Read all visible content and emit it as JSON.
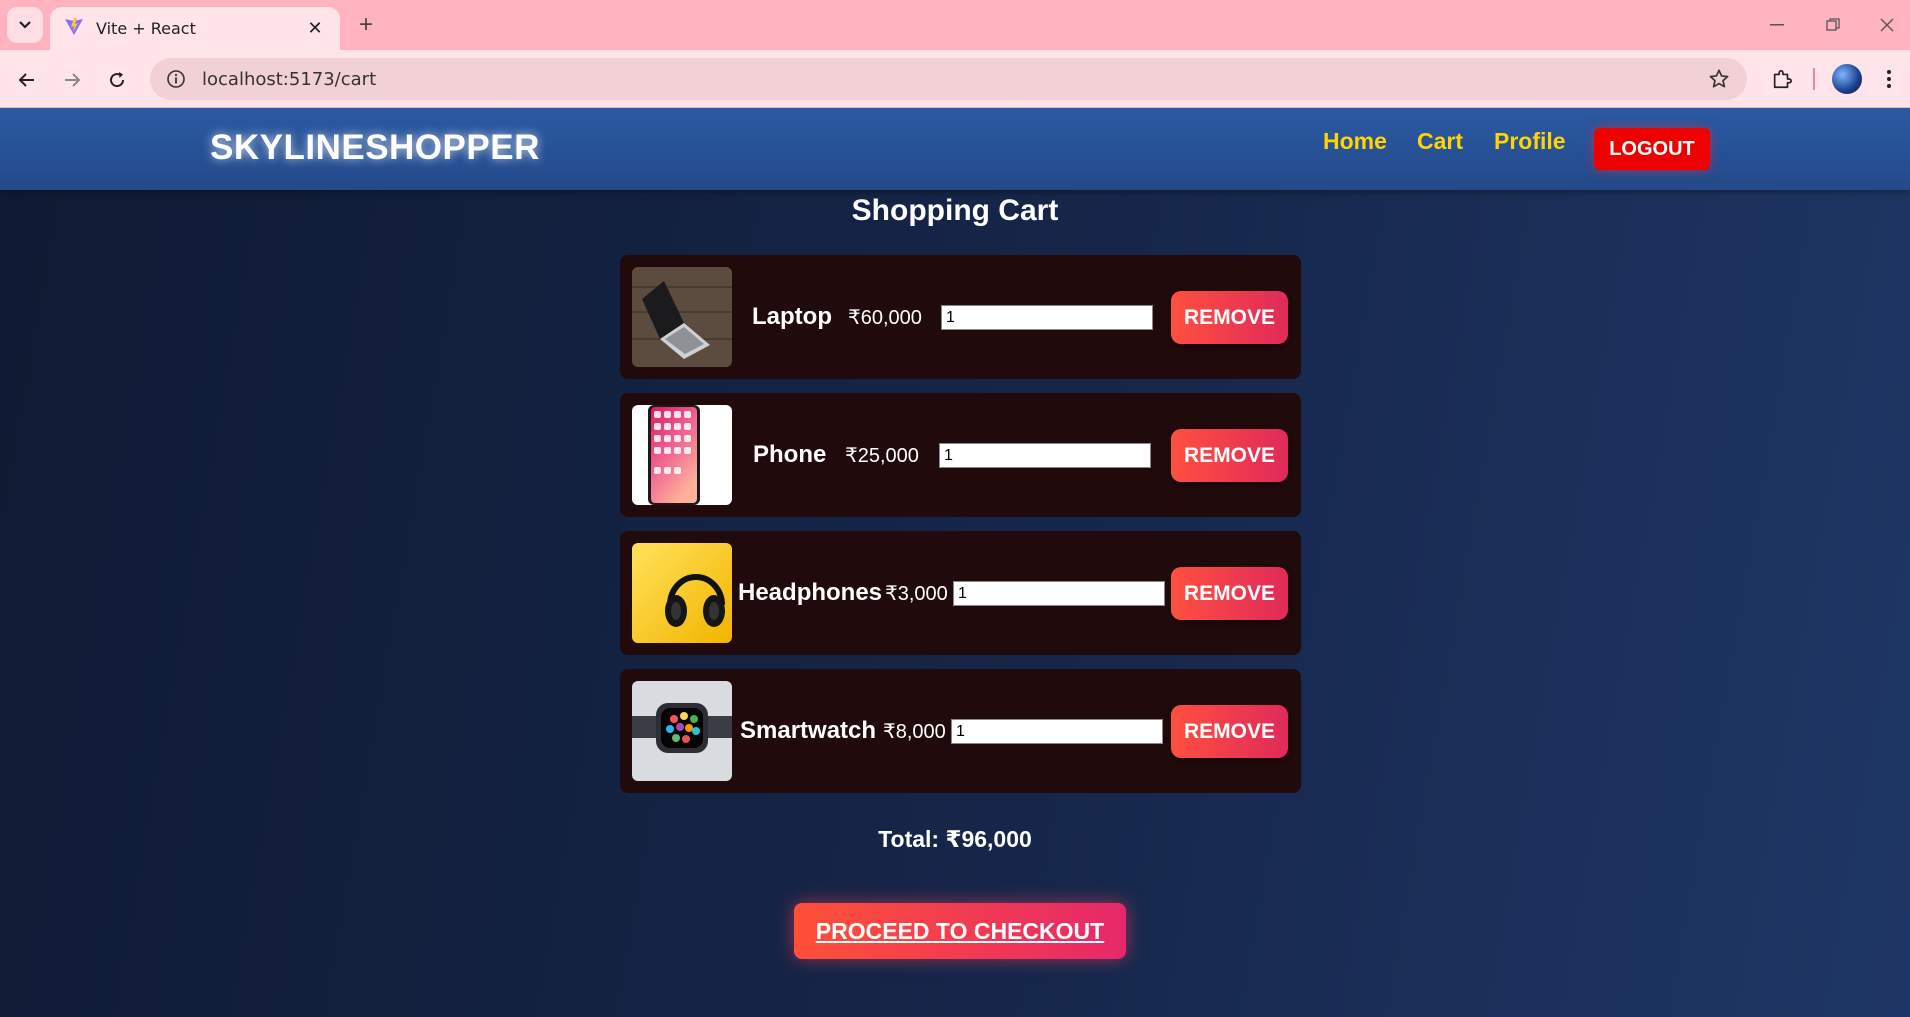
{
  "browser": {
    "tab_title": "Vite + React",
    "url": "localhost:5173/cart",
    "icons": [
      "tab-search-icon",
      "vite-favicon-icon",
      "close-icon",
      "plus-icon",
      "minimize-icon",
      "restore-icon",
      "window-close-icon",
      "back-arrow-icon",
      "forward-arrow-icon",
      "reload-icon",
      "site-info-icon",
      "star-icon",
      "extensions-icon",
      "profile-avatar-icon",
      "kebab-menu-icon"
    ]
  },
  "header": {
    "brand": "SKYLINESHOPPER",
    "nav": [
      "Home",
      "Cart",
      "Profile"
    ],
    "logout": "LOGOUT"
  },
  "cart": {
    "title": "Shopping Cart",
    "items": [
      {
        "name": "Laptop",
        "price": "₹60,000",
        "qty": "1",
        "remove": "REMOVE",
        "image": "laptop-photo"
      },
      {
        "name": "Phone",
        "price": "₹25,000",
        "qty": "1",
        "remove": "REMOVE",
        "image": "phone-photo"
      },
      {
        "name": "Headphones",
        "price": "₹3,000",
        "qty": "1",
        "remove": "REMOVE",
        "image": "headphones-photo"
      },
      {
        "name": "Smartwatch",
        "price": "₹8,000",
        "qty": "1",
        "remove": "REMOVE",
        "image": "smartwatch-photo"
      }
    ],
    "total": "Total: ₹96,000",
    "checkout": "PROCEED TO CHECKOUT"
  },
  "colors": {
    "tabstrip": "#ffb3c1",
    "header": "#2a5aa3",
    "nav_link": "#ffd400",
    "logout": "#ee0000",
    "item_card": "#200a0c",
    "button_gradient_start": "#ff4f3f",
    "button_gradient_end": "#e02a5a"
  }
}
